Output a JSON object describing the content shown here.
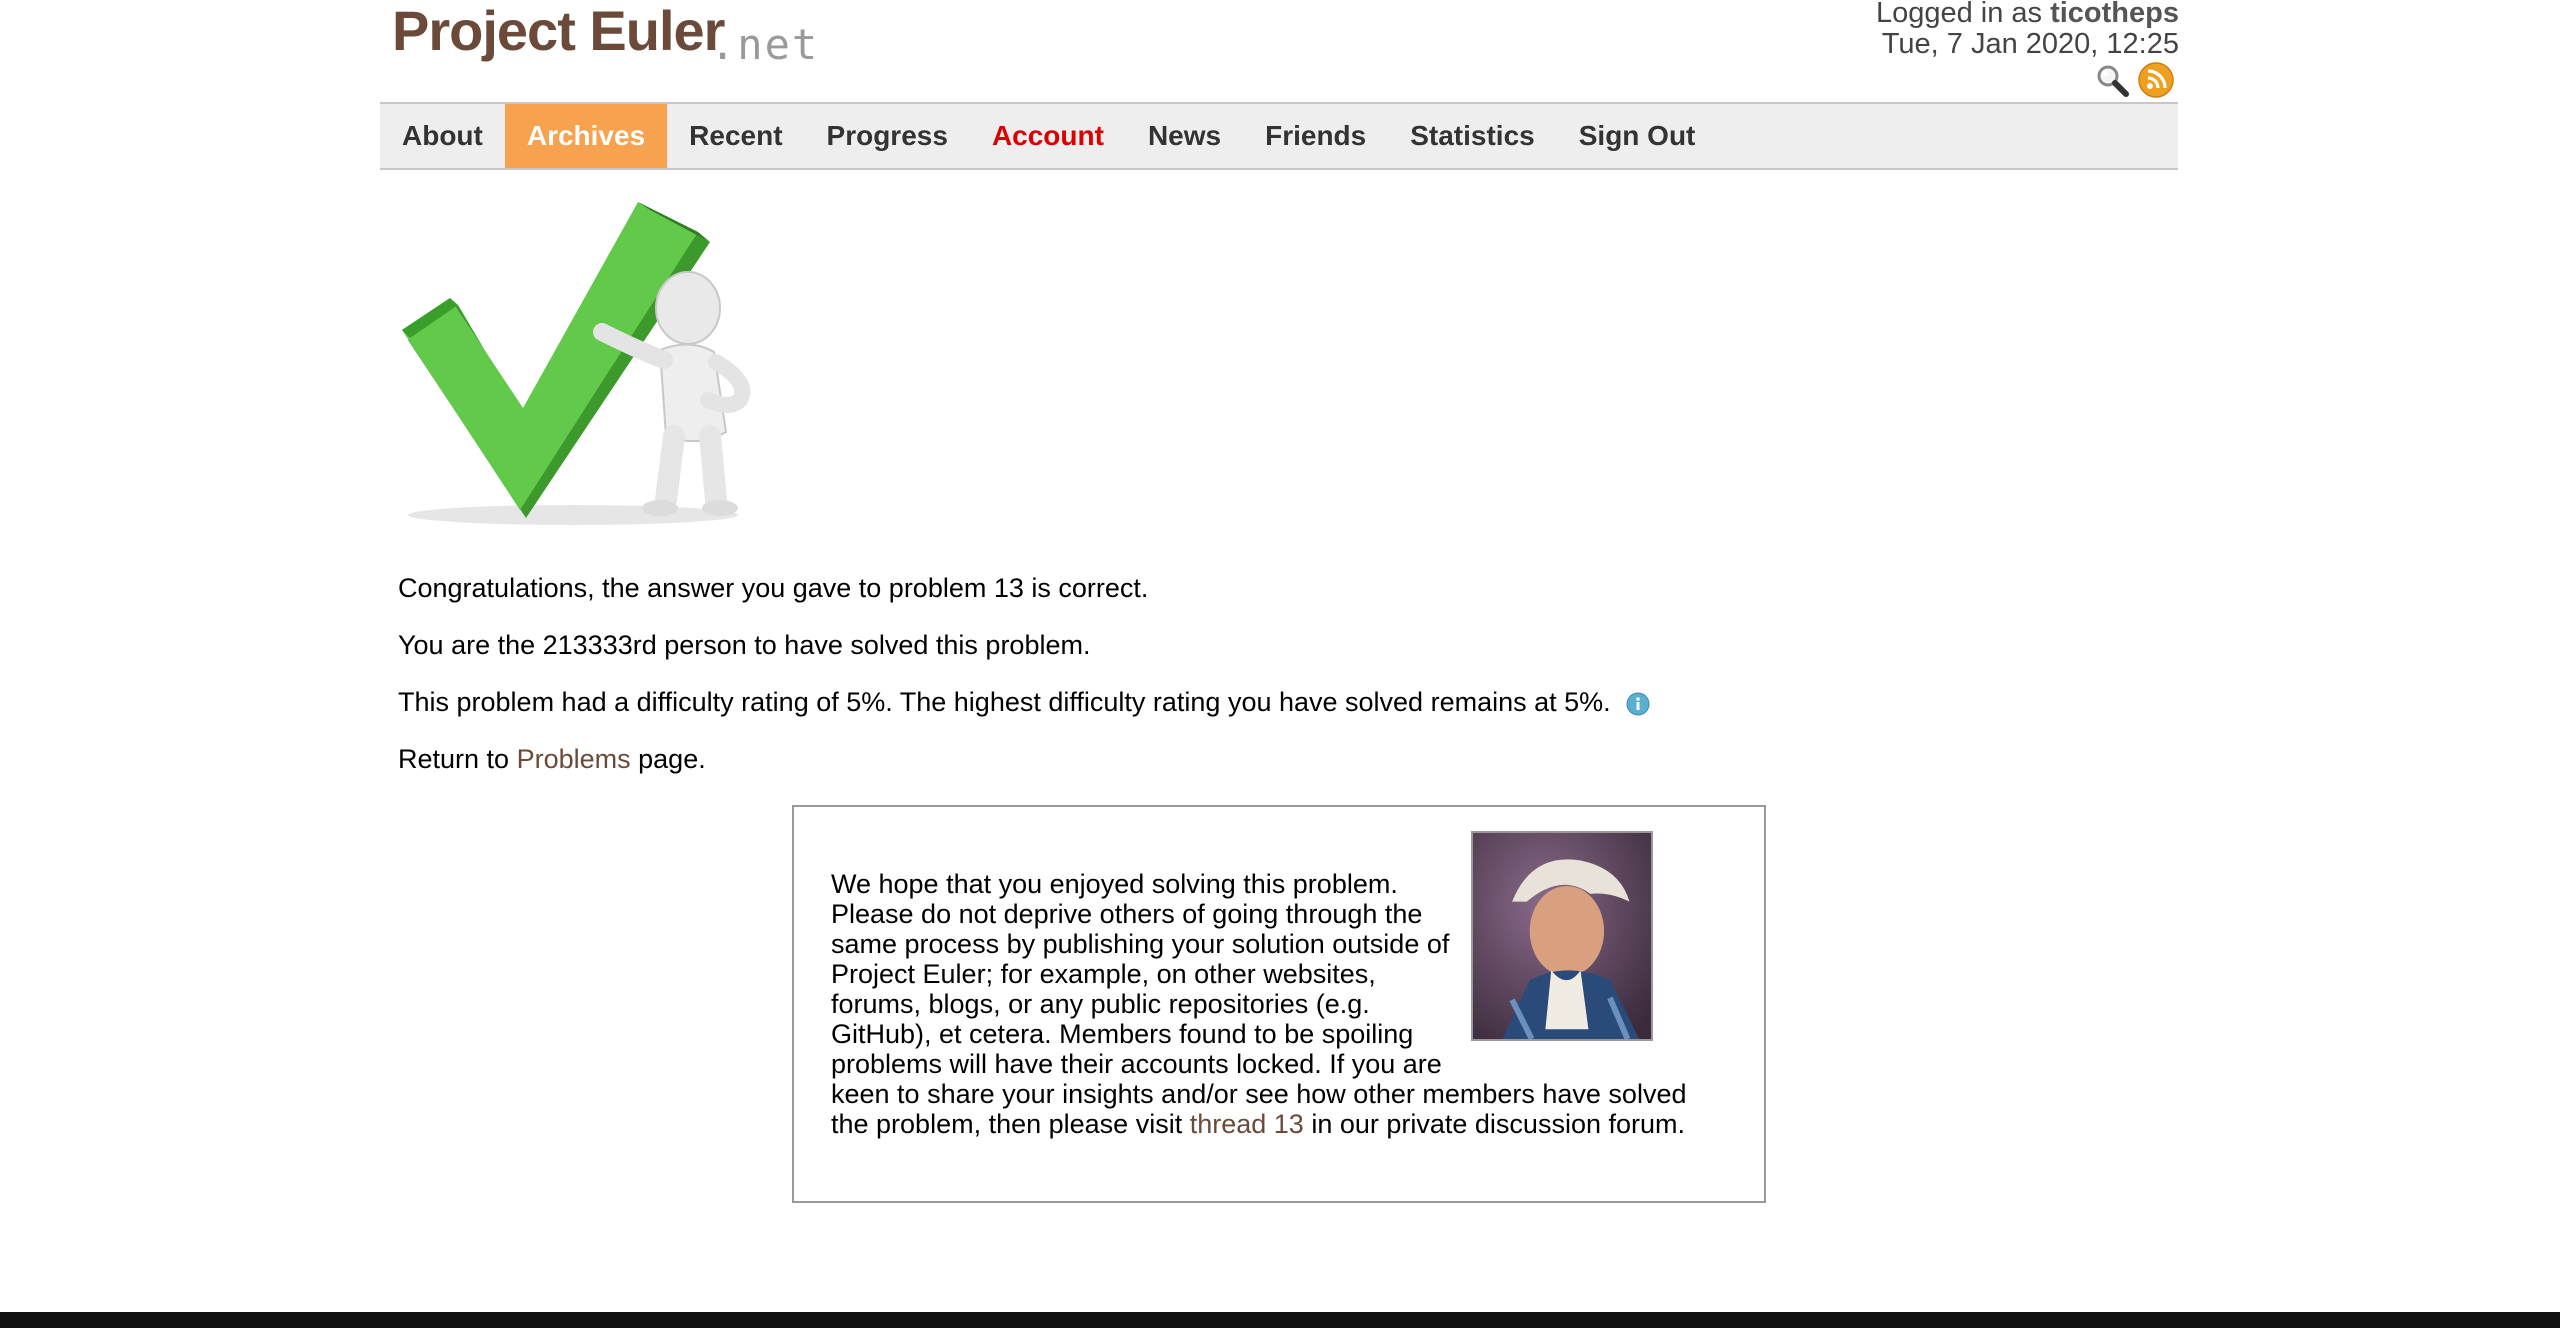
{
  "header": {
    "logo_text": "Project Euler",
    "logo_suffix": ".net",
    "logged_in_prefix": "Logged in as",
    "username": "ticotheps",
    "datetime": "Tue, 7 Jan 2020, 12:25",
    "icons": [
      "search-icon",
      "rss-icon"
    ]
  },
  "nav": {
    "items": [
      {
        "label": "About"
      },
      {
        "label": "Archives"
      },
      {
        "label": "Recent"
      },
      {
        "label": "Progress"
      },
      {
        "label": "Account"
      },
      {
        "label": "News"
      },
      {
        "label": "Friends"
      },
      {
        "label": "Statistics"
      },
      {
        "label": "Sign Out"
      }
    ],
    "active_color": "#f7a24e",
    "highlight_color": "#dd0000"
  },
  "result": {
    "congrats": "Congratulations, the answer you gave to problem 13 is correct.",
    "rank": "You are the 213333rd person to have solved this problem.",
    "difficulty": "This problem had a difficulty rating of 5%. The highest difficulty rating you have solved remains at 5%.",
    "return_prefix": "Return to",
    "return_link": "Problems",
    "return_suffix": "page."
  },
  "notice": {
    "text_before": "We hope that you enjoyed solving this problem. Please do not deprive others of going through the same process by publishing your solution outside of Project Euler; for example, on other websites, forums, blogs, or any public repositories (e.g. GitHub), et cetera. Members found to be spoiling problems will have their accounts locked. If you are keen to share your insights and/or see how other members have solved the problem, then please visit",
    "thread_link": "thread 13",
    "text_after": "in our private discussion forum."
  }
}
